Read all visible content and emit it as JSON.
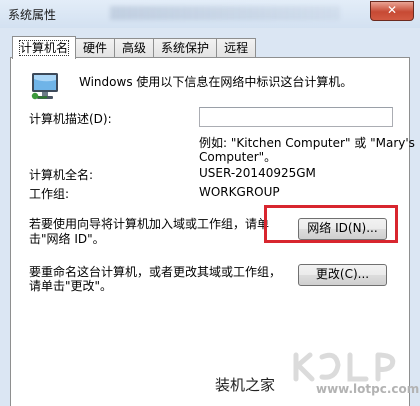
{
  "window": {
    "title": "系统属性",
    "close_label": "✕"
  },
  "tabs": [
    {
      "label": "计算机名",
      "active": true
    },
    {
      "label": "硬件",
      "active": false
    },
    {
      "label": "高级",
      "active": false
    },
    {
      "label": "系统保护",
      "active": false
    },
    {
      "label": "远程",
      "active": false
    }
  ],
  "content": {
    "intro_text": "Windows 使用以下信息在网络中标识这台计算机。",
    "description_label": "计算机描述(D):",
    "description_value": "",
    "example_line1": "例如: \"Kitchen Computer\" 或 \"Mary's",
    "example_line2": "Computer\"。",
    "fullname_label": "计算机全名:",
    "fullname_value": "USER-20140925GM",
    "workgroup_label": "工作组:",
    "workgroup_value": "WORKGROUP",
    "network_id_text_line1": "若要使用向导将计算机加入域或工作组，请单",
    "network_id_text_line2": "击\"网络 ID\"。",
    "network_id_button": "网络 ID(N)...",
    "rename_text_line1": "要重命名这台计算机，或者更改其域或工作组，",
    "rename_text_line2": "请单击\"更改\"。",
    "change_button": "更改(C)..."
  },
  "watermark": {
    "brand": "装机之家",
    "url": "www.lotpc.com"
  },
  "colors": {
    "highlight": "#d8262f",
    "window_frame": "#dbe6f3"
  }
}
